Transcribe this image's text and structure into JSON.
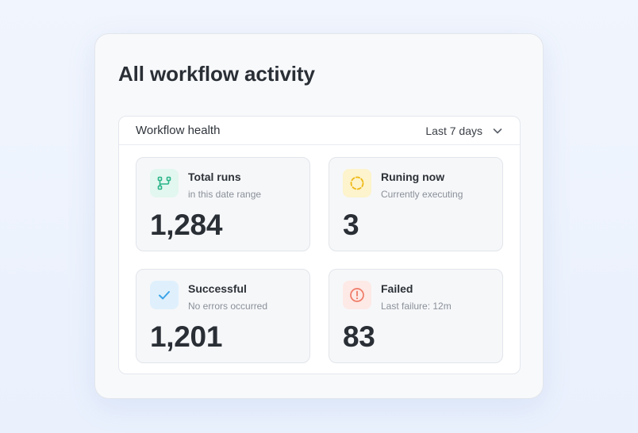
{
  "page": {
    "title": "All workflow activity"
  },
  "panel": {
    "title": "Workflow health",
    "range": {
      "selected": "Last 7 days",
      "icon": "chevron-down-icon"
    }
  },
  "stats": [
    {
      "title": "Total runs",
      "subtitle": "in this date range",
      "value": "1,284",
      "icon": "workflow-branch-icon",
      "tile_color": "#e2f7ef",
      "icon_color": "#2bb58a"
    },
    {
      "title": "Runing now",
      "subtitle": "Currently executing",
      "value": "3",
      "icon": "spinner-icon",
      "tile_color": "#fdf3cc",
      "icon_color": "#efb814"
    },
    {
      "title": "Successful",
      "subtitle": "No errors occurred",
      "value": "1,201",
      "icon": "checkmark-icon",
      "tile_color": "#dff0fc",
      "icon_color": "#3ba3e8"
    },
    {
      "title": "Failed",
      "subtitle": "Last failure: 12m",
      "value": "83",
      "icon": "alert-circle-icon",
      "tile_color": "#fde9e6",
      "icon_color": "#ef7a66"
    }
  ]
}
